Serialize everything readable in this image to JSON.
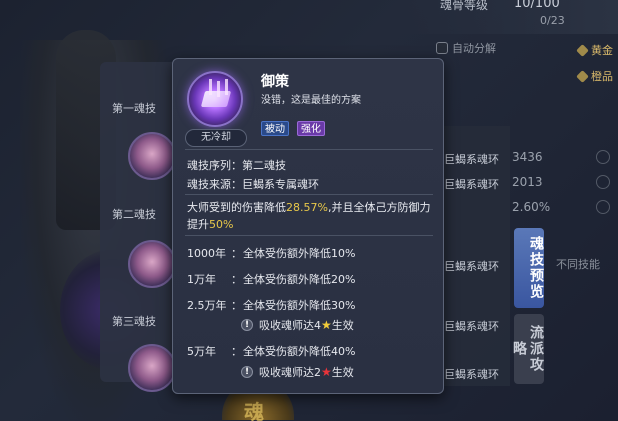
{
  "background": {
    "top_label": "魂骨等级",
    "top_value": "10/100",
    "top_count": "0/23",
    "checkbox_label": "自动分解",
    "side_rows": [
      "黄金",
      "橙品"
    ],
    "emblem_text": "魂"
  },
  "left_panel": {
    "sections": [
      "第一魂技",
      "第二魂技",
      "第三魂技"
    ]
  },
  "right_panel": {
    "rows": [
      {
        "text": "巨蝎系魂环",
        "num": "3436"
      },
      {
        "text": "巨蝎系魂环",
        "num": "2013"
      },
      {
        "text": "",
        "num": "2.60%"
      },
      {
        "text": "巨蝎系魂环",
        "num": ""
      },
      {
        "text": "巨蝎系魂环",
        "num": ""
      },
      {
        "text": "巨蝎系魂环",
        "num": ""
      }
    ],
    "end_text": "不同技能",
    "tab_active": "魂技预览",
    "tab_inactive": "流派攻略"
  },
  "popup": {
    "cooldown": "无冷却",
    "skill_name": "御策",
    "quote": "没错，这是最佳的方案",
    "tags": [
      "被动",
      "强化"
    ],
    "sequence_label": "魂技序列：",
    "sequence_value": "第二魂技",
    "source_label": "魂技来源：",
    "source_value": "巨蝎系专属魂环",
    "description": {
      "part1": "大师受到的伤害降低",
      "value1": "28.57%",
      "part2": ",并且全体己方防御力提升",
      "value2": "50%"
    },
    "tiers": [
      {
        "year": "1000年",
        "colon": "：",
        "effect": "全体受伤额外降低10%"
      },
      {
        "year": "1万年",
        "colon": "：",
        "effect": "全体受伤额外降低20%"
      },
      {
        "year": "2.5万年",
        "colon": "：",
        "effect": "全体受伤额外降低30%"
      },
      {
        "year": "5万年",
        "colon": "：",
        "effect": "全体受伤额外降低40%"
      }
    ],
    "conditions": [
      {
        "pre": "吸收魂师达4",
        "post": "生效",
        "star_color": "#f2cc3a"
      },
      {
        "pre": "吸收魂师达2",
        "post": "生效",
        "star_color": "#e8343a"
      }
    ],
    "warn_symbol": "!",
    "star_symbol": "★"
  }
}
